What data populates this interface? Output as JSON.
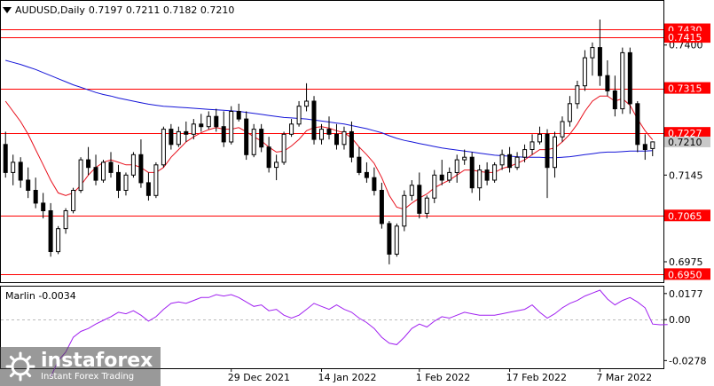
{
  "header": {
    "symbol_timeframe": "AUDUSD,Daily",
    "ohlc": "0.7197 0.7211 0.7182 0.7210"
  },
  "oscillator": {
    "title": "Marlin -0.0034",
    "axis_labels": [
      "0.0177",
      "0.00",
      "-0.0278"
    ]
  },
  "watermark": {
    "brand": "instaforex",
    "tagline": "Instant Forex Trading"
  },
  "colors": {
    "level_line": "#ff0000",
    "ma_fast": "#e8101c",
    "ma_slow": "#1515d8",
    "oscillator_line": "#a020f0",
    "price_tag_bg": "#ff0000",
    "current_price_bg": "#c8c8c8",
    "candle_bull": "#ffffff",
    "candle_bear": "#000000"
  },
  "chart_data": {
    "type": "candlestick",
    "symbol": "AUDUSD",
    "timeframe": "Daily",
    "price_axis": {
      "range": [
        0.6935,
        0.745
      ],
      "labels": [
        "0.7400",
        "0.7145",
        "0.6975"
      ],
      "level_labels": [
        "0.7430",
        "0.7415",
        "0.7315",
        "0.7227",
        "0.7065",
        "0.6950"
      ],
      "current_price": "0.7210"
    },
    "levels": [
      0.743,
      0.7415,
      0.7315,
      0.7227,
      0.7065,
      0.695
    ],
    "date_labels": [
      {
        "text": "29 Dec 2021",
        "index": 30
      },
      {
        "text": "14 Jan 2022",
        "index": 42
      },
      {
        "text": "1 Feb 2022",
        "index": 55
      },
      {
        "text": "17 Feb 2022",
        "index": 67
      },
      {
        "text": "7 Mar 2022",
        "index": 79
      }
    ],
    "candles": [
      [
        0.7205,
        0.723,
        0.714,
        0.715
      ],
      [
        0.715,
        0.7185,
        0.7125,
        0.717
      ],
      [
        0.717,
        0.718,
        0.712,
        0.7135
      ],
      [
        0.7135,
        0.716,
        0.71,
        0.7115
      ],
      [
        0.7115,
        0.714,
        0.708,
        0.709
      ],
      [
        0.709,
        0.711,
        0.706,
        0.7075
      ],
      [
        0.7075,
        0.709,
        0.6985,
        0.6995
      ],
      [
        0.6995,
        0.7045,
        0.699,
        0.704
      ],
      [
        0.704,
        0.708,
        0.703,
        0.7075
      ],
      [
        0.7075,
        0.712,
        0.707,
        0.7115
      ],
      [
        0.7115,
        0.718,
        0.711,
        0.7175
      ],
      [
        0.7175,
        0.72,
        0.7145,
        0.716
      ],
      [
        0.716,
        0.7185,
        0.7125,
        0.7135
      ],
      [
        0.7135,
        0.7175,
        0.713,
        0.717
      ],
      [
        0.717,
        0.719,
        0.714,
        0.715
      ],
      [
        0.715,
        0.7165,
        0.71,
        0.7115
      ],
      [
        0.7115,
        0.715,
        0.7105,
        0.7145
      ],
      [
        0.7145,
        0.719,
        0.714,
        0.7185
      ],
      [
        0.7185,
        0.7215,
        0.712,
        0.713
      ],
      [
        0.713,
        0.715,
        0.7095,
        0.7105
      ],
      [
        0.7105,
        0.717,
        0.71,
        0.7165
      ],
      [
        0.7165,
        0.724,
        0.716,
        0.7235
      ],
      [
        0.7235,
        0.7245,
        0.7195,
        0.7205
      ],
      [
        0.7205,
        0.724,
        0.72,
        0.723
      ],
      [
        0.723,
        0.725,
        0.721,
        0.7225
      ],
      [
        0.7225,
        0.7255,
        0.7215,
        0.7245
      ],
      [
        0.7245,
        0.7265,
        0.723,
        0.724
      ],
      [
        0.724,
        0.727,
        0.7235,
        0.726
      ],
      [
        0.726,
        0.7275,
        0.723,
        0.724
      ],
      [
        0.724,
        0.727,
        0.72,
        0.721
      ],
      [
        0.721,
        0.728,
        0.7205,
        0.727
      ],
      [
        0.727,
        0.7285,
        0.725,
        0.7255
      ],
      [
        0.7255,
        0.727,
        0.7175,
        0.7185
      ],
      [
        0.7185,
        0.7245,
        0.718,
        0.7235
      ],
      [
        0.7235,
        0.7245,
        0.719,
        0.72
      ],
      [
        0.72,
        0.722,
        0.715,
        0.716
      ],
      [
        0.716,
        0.7185,
        0.7135,
        0.717
      ],
      [
        0.717,
        0.723,
        0.7165,
        0.7225
      ],
      [
        0.7225,
        0.7255,
        0.722,
        0.7245
      ],
      [
        0.7245,
        0.729,
        0.724,
        0.728
      ],
      [
        0.728,
        0.7325,
        0.727,
        0.729
      ],
      [
        0.729,
        0.73,
        0.7205,
        0.7215
      ],
      [
        0.7215,
        0.7245,
        0.7205,
        0.7235
      ],
      [
        0.7235,
        0.726,
        0.7215,
        0.7225
      ],
      [
        0.7225,
        0.7245,
        0.7195,
        0.7205
      ],
      [
        0.7205,
        0.724,
        0.7195,
        0.723
      ],
      [
        0.723,
        0.725,
        0.717,
        0.718
      ],
      [
        0.718,
        0.72,
        0.7145,
        0.715
      ],
      [
        0.715,
        0.717,
        0.713,
        0.714
      ],
      [
        0.714,
        0.716,
        0.7105,
        0.7115
      ],
      [
        0.7115,
        0.713,
        0.704,
        0.705
      ],
      [
        0.705,
        0.7055,
        0.697,
        0.699
      ],
      [
        0.699,
        0.705,
        0.6985,
        0.7045
      ],
      [
        0.7045,
        0.7115,
        0.7035,
        0.7105
      ],
      [
        0.7105,
        0.7135,
        0.7095,
        0.7125
      ],
      [
        0.7125,
        0.715,
        0.706,
        0.707
      ],
      [
        0.707,
        0.7105,
        0.706,
        0.71
      ],
      [
        0.71,
        0.7155,
        0.709,
        0.7145
      ],
      [
        0.7145,
        0.7175,
        0.7125,
        0.7135
      ],
      [
        0.7135,
        0.716,
        0.713,
        0.715
      ],
      [
        0.715,
        0.7185,
        0.713,
        0.7175
      ],
      [
        0.7175,
        0.7195,
        0.7165,
        0.718
      ],
      [
        0.718,
        0.719,
        0.711,
        0.712
      ],
      [
        0.712,
        0.7165,
        0.7095,
        0.7155
      ],
      [
        0.7155,
        0.717,
        0.7125,
        0.7135
      ],
      [
        0.7135,
        0.717,
        0.713,
        0.7165
      ],
      [
        0.7165,
        0.7195,
        0.7155,
        0.7185
      ],
      [
        0.7185,
        0.72,
        0.715,
        0.716
      ],
      [
        0.716,
        0.719,
        0.7155,
        0.718
      ],
      [
        0.718,
        0.7205,
        0.717,
        0.7195
      ],
      [
        0.7195,
        0.7225,
        0.7185,
        0.721
      ],
      [
        0.721,
        0.724,
        0.7205,
        0.7225
      ],
      [
        0.7225,
        0.7235,
        0.71,
        0.716
      ],
      [
        0.716,
        0.723,
        0.714,
        0.722
      ],
      [
        0.722,
        0.726,
        0.721,
        0.725
      ],
      [
        0.725,
        0.73,
        0.724,
        0.7285
      ],
      [
        0.7285,
        0.733,
        0.7275,
        0.732
      ],
      [
        0.732,
        0.739,
        0.731,
        0.7375
      ],
      [
        0.7375,
        0.7405,
        0.734,
        0.7395
      ],
      [
        0.7395,
        0.745,
        0.732,
        0.734
      ],
      [
        0.734,
        0.737,
        0.73,
        0.731
      ],
      [
        0.731,
        0.734,
        0.726,
        0.7275
      ],
      [
        0.7275,
        0.7395,
        0.7265,
        0.7385
      ],
      [
        0.7385,
        0.7395,
        0.7265,
        0.7285
      ],
      [
        0.7285,
        0.729,
        0.719,
        0.7205
      ],
      [
        0.7205,
        0.7225,
        0.7175,
        0.7195
      ],
      [
        0.7197,
        0.7211,
        0.7182,
        0.721
      ]
    ],
    "ma_fast": [
      0.729,
      0.727,
      0.725,
      0.7225,
      0.7195,
      0.7165,
      0.7135,
      0.711,
      0.7105,
      0.711,
      0.7125,
      0.7145,
      0.716,
      0.717,
      0.7175,
      0.717,
      0.7165,
      0.7165,
      0.716,
      0.715,
      0.715,
      0.716,
      0.718,
      0.7195,
      0.721,
      0.722,
      0.7228,
      0.7234,
      0.7238,
      0.7235,
      0.7235,
      0.7238,
      0.723,
      0.722,
      0.7212,
      0.72,
      0.719,
      0.7192,
      0.7202,
      0.7215,
      0.7232,
      0.7238,
      0.724,
      0.7237,
      0.7232,
      0.7228,
      0.7218,
      0.72,
      0.7185,
      0.7168,
      0.714,
      0.7105,
      0.7082,
      0.7078,
      0.709,
      0.71,
      0.7108,
      0.712,
      0.7128,
      0.7135,
      0.7145,
      0.7155,
      0.7155,
      0.7152,
      0.715,
      0.715,
      0.7158,
      0.7162,
      0.7168,
      0.7175,
      0.7185,
      0.7195,
      0.7195,
      0.7198,
      0.721,
      0.7225,
      0.7245,
      0.727,
      0.729,
      0.73,
      0.73,
      0.729,
      0.7295,
      0.7282,
      0.7255,
      0.7232,
      0.7214
    ],
    "ma_slow": [
      0.737,
      0.7366,
      0.7362,
      0.7357,
      0.7352,
      0.7346,
      0.734,
      0.7334,
      0.7328,
      0.7322,
      0.7317,
      0.7312,
      0.7307,
      0.7303,
      0.73,
      0.7296,
      0.7293,
      0.729,
      0.7287,
      0.7284,
      0.7282,
      0.728,
      0.7279,
      0.7278,
      0.7277,
      0.7276,
      0.7275,
      0.7274,
      0.7273,
      0.7272,
      0.7271,
      0.727,
      0.7268,
      0.7266,
      0.7264,
      0.7262,
      0.726,
      0.7258,
      0.7257,
      0.7256,
      0.7255,
      0.7253,
      0.7251,
      0.7249,
      0.7247,
      0.7245,
      0.7242,
      0.7239,
      0.7236,
      0.7232,
      0.7228,
      0.7222,
      0.7217,
      0.7213,
      0.721,
      0.7207,
      0.7204,
      0.7201,
      0.7198,
      0.7196,
      0.7194,
      0.7192,
      0.719,
      0.7188,
      0.7186,
      0.7184,
      0.7183,
      0.7182,
      0.7181,
      0.718,
      0.718,
      0.718,
      0.7179,
      0.7179,
      0.718,
      0.7181,
      0.7183,
      0.7185,
      0.7187,
      0.7189,
      0.719,
      0.719,
      0.7191,
      0.7192,
      0.7192,
      0.7192,
      0.7193
    ],
    "oscillator": {
      "name": "Marlin",
      "range": [
        -0.03,
        0.02
      ],
      "zero_line": 0,
      "start_index": 6,
      "values": [
        -0.039,
        -0.028,
        -0.022,
        -0.012,
        -0.008,
        -0.006,
        -0.003,
        -0.0005,
        0.002,
        0.005,
        0.004,
        0.006,
        0.003,
        -0.001,
        0.002,
        0.007,
        0.011,
        0.012,
        0.011,
        0.013,
        0.015,
        0.015,
        0.017,
        0.016,
        0.017,
        0.015,
        0.012,
        0.009,
        0.01,
        0.006,
        0.007,
        0.003,
        0.001,
        0.003,
        0.007,
        0.011,
        0.009,
        0.007,
        0.01,
        0.007,
        0.005,
        0.001,
        -0.002,
        -0.006,
        -0.012,
        -0.016,
        -0.017,
        -0.012,
        -0.006,
        -0.003,
        -0.005,
        -0.001,
        0.002,
        0.001,
        0.003,
        0.005,
        0.004,
        0.003,
        0.003,
        0.003,
        0.004,
        0.005,
        0.006,
        0.007,
        0.01,
        0.005,
        0.001,
        0.004,
        0.008,
        0.011,
        0.013,
        0.016,
        0.018,
        0.02,
        0.014,
        0.01,
        0.013,
        0.015,
        0.012,
        0.008,
        -0.003,
        -0.0035,
        -0.0034
      ]
    }
  }
}
